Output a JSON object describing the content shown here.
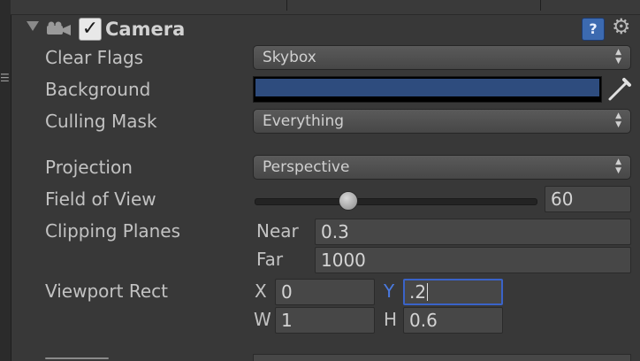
{
  "component": {
    "title": "Camera",
    "enabled": true,
    "icon": "camera-icon"
  },
  "clear_flags": {
    "label": "Clear Flags",
    "value": "Skybox"
  },
  "background": {
    "label": "Background",
    "color": "#2e4c7e"
  },
  "culling_mask": {
    "label": "Culling Mask",
    "value": "Everything"
  },
  "projection": {
    "label": "Projection",
    "value": "Perspective"
  },
  "field_of_view": {
    "label": "Field of View",
    "value": "60",
    "slider_fraction": 0.33
  },
  "clipping_planes": {
    "label": "Clipping Planes",
    "near_label": "Near",
    "near": "0.3",
    "far_label": "Far",
    "far": "1000"
  },
  "viewport_rect": {
    "label": "Viewport Rect",
    "x_label": "X",
    "x": "0",
    "y_label": "Y",
    "y": ".2",
    "w_label": "W",
    "w": "1",
    "h_label": "H",
    "h": "0.6"
  },
  "colors": {
    "panel_bg": "#383838",
    "focus_accent": "#3a63c8",
    "help_icon": "#3c6ab0"
  }
}
